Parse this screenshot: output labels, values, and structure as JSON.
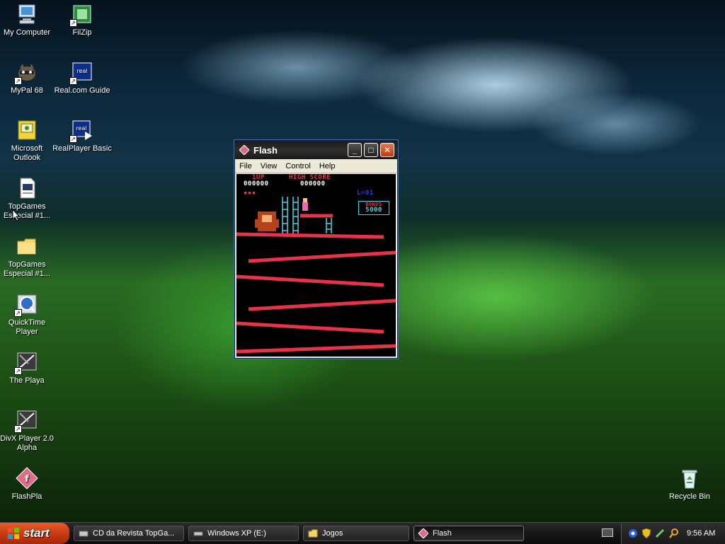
{
  "desktop": {
    "icons": [
      {
        "label": "My Computer"
      },
      {
        "label": "FilZip"
      },
      {
        "label": "MyPal 68"
      },
      {
        "label": "Real.com Guide"
      },
      {
        "label": "Microsoft Outlook"
      },
      {
        "label": "RealPlayer Basic"
      },
      {
        "label": "TopGames Especial #1..."
      },
      {
        "label": "TopGames Especial #1..."
      },
      {
        "label": "QuickTime Player"
      },
      {
        "label": "The Playa"
      },
      {
        "label": "DivX Player 2.0 Alpha"
      },
      {
        "label": "FlashPla"
      },
      {
        "label": "Recycle Bin"
      }
    ]
  },
  "window": {
    "title": "Flash",
    "menu": [
      "File",
      "View",
      "Control",
      "Help"
    ]
  },
  "game": {
    "p1_label": "1UP",
    "p1_score": "000000",
    "hs_label": "HIGH SCORE",
    "hs_score": "000000",
    "level_label": "L=01",
    "bonus_label": "BONUS",
    "bonus_value": "5000"
  },
  "taskbar": {
    "start_label": "start",
    "tasks": [
      {
        "label": "CD da Revista TopGa..."
      },
      {
        "label": "Windows XP (E:)"
      },
      {
        "label": "Jogos"
      },
      {
        "label": "Flash"
      }
    ],
    "clock": "9:56 AM"
  },
  "colors": {
    "girder": "#e8324a",
    "ladder": "#4dd2e6",
    "start": "#d9461a"
  }
}
